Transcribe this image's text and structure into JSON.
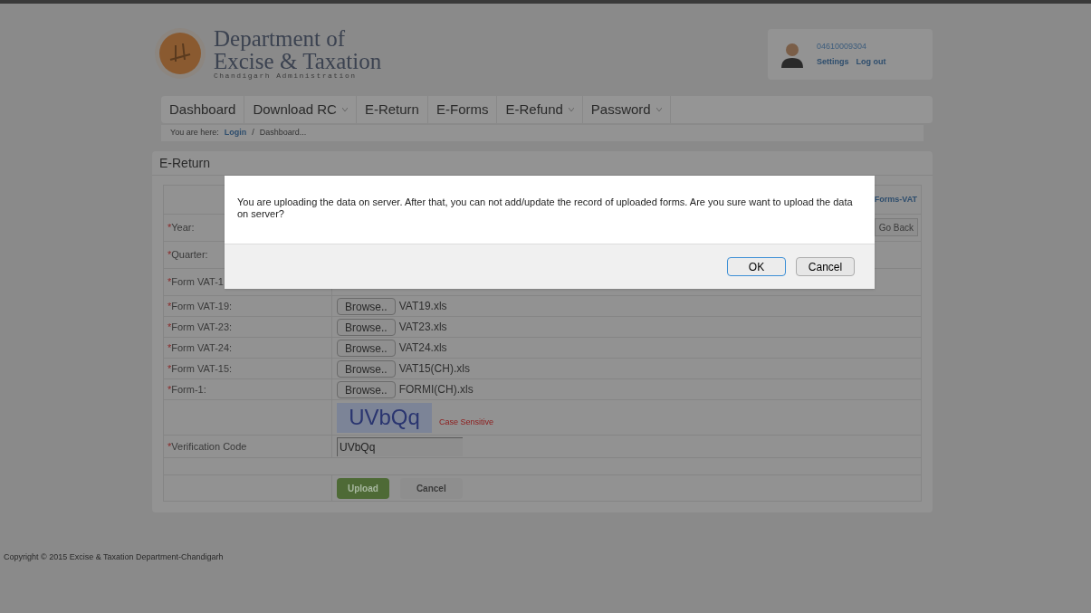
{
  "header": {
    "title_line1": "Department of",
    "title_line2": "Excise & Taxation",
    "subtitle": "Chandigarh Administration",
    "user": {
      "id": "04610009304",
      "links": [
        "Settings",
        "Log out"
      ]
    }
  },
  "nav": [
    {
      "label": "Dashboard",
      "dropdown": false
    },
    {
      "label": "Download RC",
      "dropdown": true
    },
    {
      "label": "E-Return",
      "dropdown": false
    },
    {
      "label": "E-Forms",
      "dropdown": false
    },
    {
      "label": "E-Refund",
      "dropdown": true
    },
    {
      "label": "Password",
      "dropdown": true
    }
  ],
  "breadcrumb": {
    "prefix": "You are here:",
    "separator": "/",
    "items": [
      "Login",
      "Dashboard..."
    ]
  },
  "panel": {
    "title": "E-Return",
    "top_link": "Forms-VAT",
    "go_back": "Go Back",
    "rows": [
      {
        "kind": "label",
        "mark": "*",
        "label": "Year:"
      },
      {
        "kind": "label",
        "mark": "*",
        "label": "Quarter:"
      },
      {
        "kind": "label",
        "mark": "*",
        "label": "Form VAT-1"
      },
      {
        "kind": "file",
        "mark": "*",
        "label": "Form VAT-19:",
        "button": "Browse..",
        "value": "VAT19.xls"
      },
      {
        "kind": "file",
        "mark": "*",
        "label": "Form VAT-23:",
        "button": "Browse..",
        "value": "VAT23.xls"
      },
      {
        "kind": "file",
        "mark": "*",
        "label": "Form VAT-24:",
        "button": "Browse..",
        "value": "VAT24.xls"
      },
      {
        "kind": "file",
        "mark": "*",
        "label": "Form VAT-15:",
        "button": "Browse..",
        "value": "VAT15(CH).xls"
      },
      {
        "kind": "file",
        "mark": "*",
        "label": "Form-1:",
        "button": "Browse..",
        "value": "FORMI(CH).xls"
      },
      {
        "kind": "captcha",
        "code": "UVbQq",
        "note": "Case Sensitive"
      },
      {
        "kind": "input",
        "mark": "*",
        "label": "Verification Code",
        "value": "UVbQq"
      },
      {
        "kind": "empty"
      },
      {
        "kind": "actions",
        "primary": "Upload",
        "secondary": "Cancel"
      }
    ]
  },
  "footer": "Copyright © 2015 Excise & Taxation Department-Chandigarh",
  "dialog": {
    "message": "You are uploading the data on server. After that, you can not add/update the record of uploaded forms. Are you sure want to upload the data on server?",
    "buttons": [
      {
        "label": "OK",
        "selected": true
      },
      {
        "label": "Cancel",
        "selected": false
      }
    ]
  }
}
